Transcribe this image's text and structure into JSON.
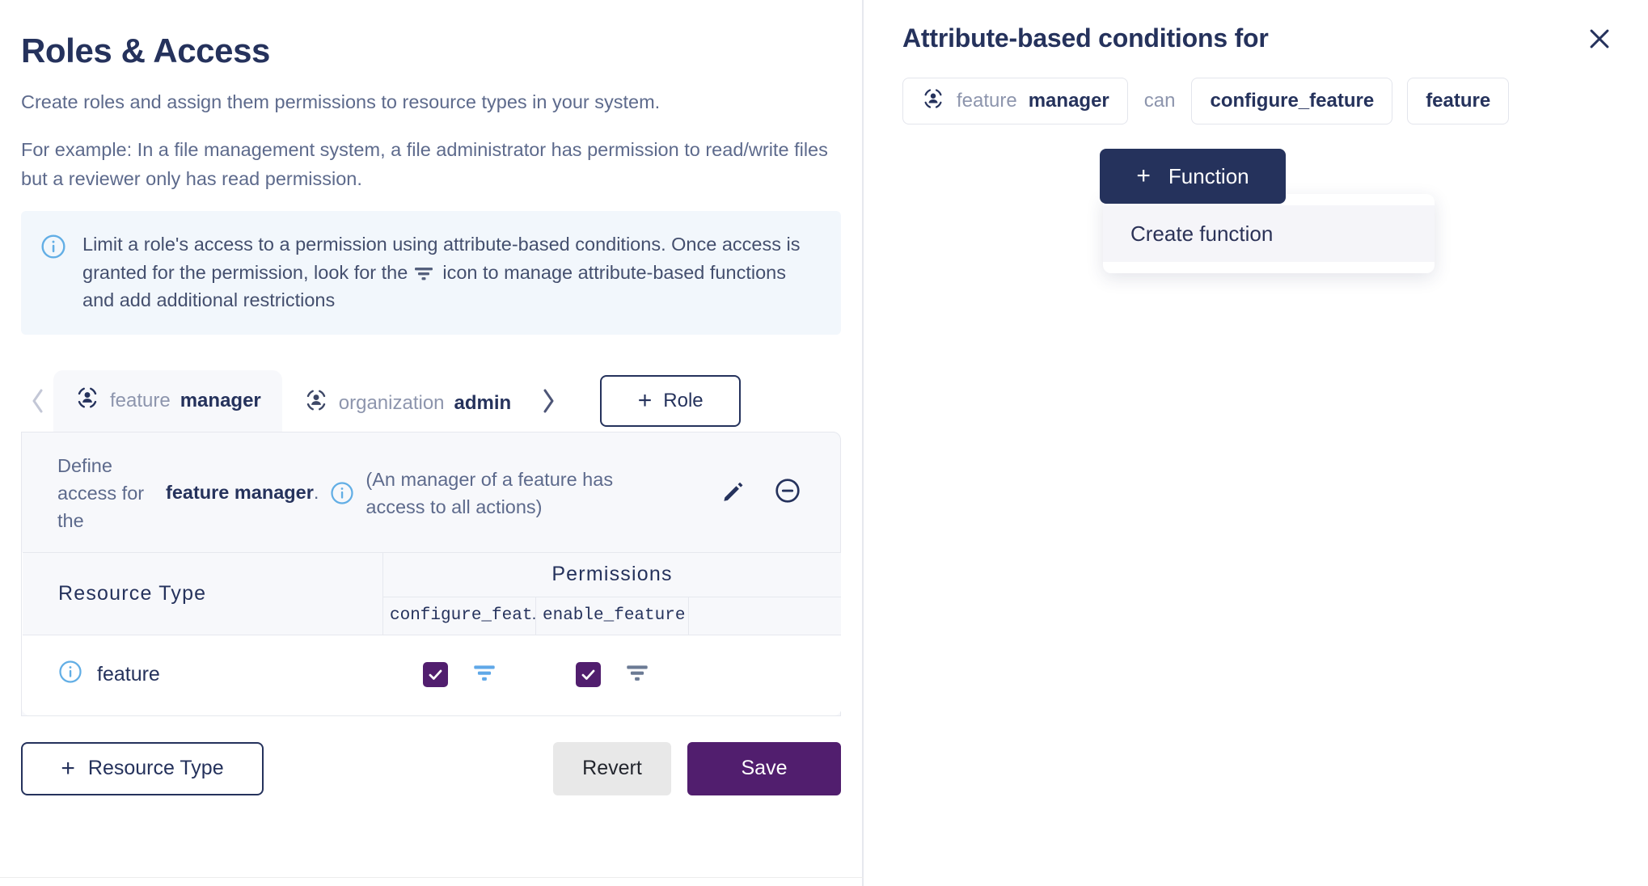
{
  "left": {
    "title": "Roles & Access",
    "subtitle_1": "Create roles and assign them permissions to resource types in your system.",
    "subtitle_2": "For example: In a file management system, a file administrator has permission to read/write files but a reviewer only has read permission.",
    "info_banner": {
      "icon": "info-circle-icon",
      "text_before_icon": "Limit a role's access to a permission using attribute-based conditions. Once access is granted for the permission, look for the",
      "inline_icon": "filter-icon",
      "text_after_icon": "icon to manage attribute-based functions and add additional restrictions"
    },
    "tabs": {
      "prev_icon": "chevron-left-icon",
      "next_icon": "chevron-right-icon",
      "items": [
        {
          "icon": "role-user-icon",
          "resource": "feature",
          "role": "manager",
          "active": true
        },
        {
          "icon": "role-user-icon",
          "resource": "organization",
          "role": "admin",
          "active": false
        }
      ],
      "add_role_label": "Role",
      "add_role_plus": "+"
    },
    "define": {
      "label_line_1": "Define",
      "label_line_2": "access for",
      "label_line_3": "the",
      "role_name": "feature manager",
      "role_name_suffix": ".",
      "info_icon": "info-circle-icon",
      "description": "(An manager of a feature has access to all actions)",
      "edit_icon": "pencil-icon",
      "remove_icon": "minus-circle-icon"
    },
    "table": {
      "col_resource_type": "Resource Type",
      "col_permissions": "Permissions",
      "permission_columns": [
        "configure_feat…",
        "enable_feature",
        ""
      ],
      "rows": [
        {
          "info_icon": "info-circle-icon",
          "resource": "feature",
          "permissions": [
            {
              "checked": true,
              "filter_icon": "filter-icon",
              "filter_active": true
            },
            {
              "checked": true,
              "filter_icon": "filter-icon",
              "filter_active": false
            }
          ]
        }
      ]
    },
    "buttons": {
      "add_resource_type": "Resource Type",
      "add_resource_type_plus": "+",
      "revert": "Revert",
      "save": "Save"
    }
  },
  "right": {
    "title": "Attribute-based conditions for",
    "close_icon": "close-icon",
    "chips": {
      "role_icon": "role-user-icon",
      "role_resource": "feature",
      "role_name": "manager",
      "connector": "can",
      "action": "configure_feature",
      "resource": "feature"
    },
    "function_button": {
      "plus": "+",
      "label": "Function"
    },
    "dropdown": {
      "items": [
        "Create function"
      ]
    }
  },
  "colors": {
    "navy": "#25325c",
    "muted": "#5d6a8c",
    "purple": "#511e6e",
    "info_blue": "#62aee5",
    "filter_active": "#5fa8e8",
    "filter_inactive": "#6b7a94",
    "banner_bg": "#f2f7fc",
    "panel_bg": "#f7f8fb",
    "revert_bg": "#e8e8e8"
  }
}
